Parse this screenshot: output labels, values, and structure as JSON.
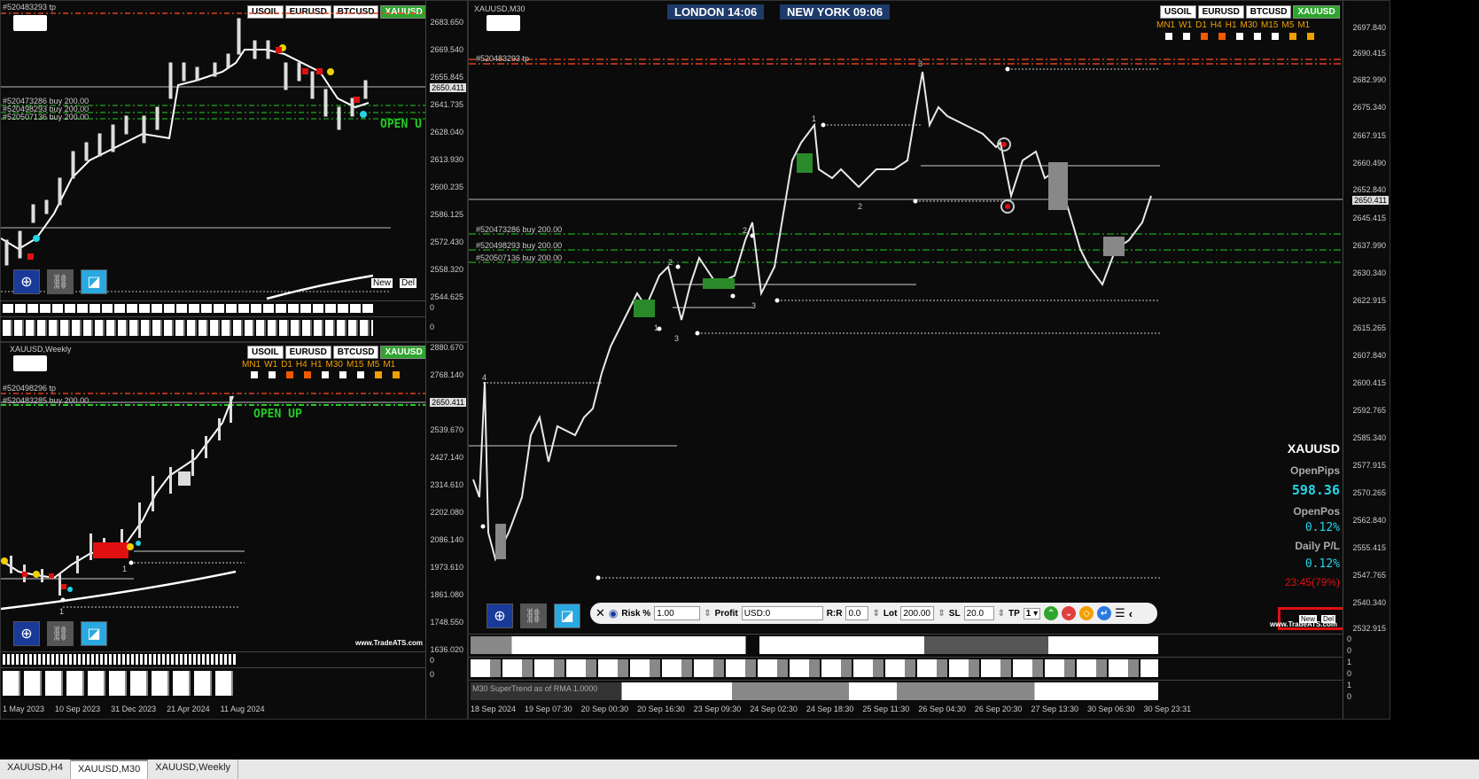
{
  "symbols": [
    "USOIL",
    "EURUSD",
    "BTCUSD",
    "XAUUSD"
  ],
  "active_symbol": "XAUUSD",
  "timeframes": [
    "MN1",
    "W1",
    "D1",
    "H4",
    "H1",
    "M30",
    "M15",
    "M5",
    "M1"
  ],
  "tabs": [
    {
      "label": "XAUUSD,H4"
    },
    {
      "label": "XAUUSD,M30"
    },
    {
      "label": "XAUUSD,Weekly"
    }
  ],
  "top_left": {
    "title": "#520483293 tp",
    "prices": [
      "2683.650",
      "2669.540",
      "2655.845",
      "2641.735",
      "2628.040",
      "2613.930",
      "2600.235",
      "2586.125",
      "2572.430",
      "2558.320",
      "2544.625"
    ],
    "current_price": "2650.411",
    "orders": [
      "#520473286 buy 200.00",
      "#520498293 buy 200.00",
      "#520507136 buy 200.00"
    ],
    "status": "OPEN U",
    "new_label": "New",
    "del_label": "Del",
    "indicator_zero": "0",
    "indicator_zero2": "0"
  },
  "bottom_left": {
    "title": "XAUUSD,Weekly",
    "tp_label": "#520498296 tp",
    "order_label": "#520483285 buy 200.00",
    "prices": [
      "2880.670",
      "2768.140",
      "2652.195",
      "2539.670",
      "2427.140",
      "2314.610",
      "2202.080",
      "2086.140",
      "1973.610",
      "1861.080",
      "1748.550",
      "1636.020"
    ],
    "current_price": "2650.411",
    "status": "OPEN UP",
    "watermark": "www.TradeATS.com",
    "dates": [
      "1 May 2023",
      "10 Sep 2023",
      "31 Dec 2023",
      "21 Apr 2024",
      "11 Aug 2024"
    ],
    "indicator_zero": "0",
    "indicator_zero2": "0",
    "wave_labels": [
      "1",
      "1"
    ]
  },
  "main": {
    "title": "XAUUSD,M30",
    "london": "LONDON  14:06",
    "newyork": "NEW YORK  09:06",
    "tp_label": "#520483293 tp",
    "orders": [
      "#520473286 buy 200.00",
      "#520498293 buy 200.00",
      "#520507136 buy 200.00"
    ],
    "prices": [
      "2697.840",
      "2690.415",
      "2682.990",
      "2675.340",
      "2667.915",
      "2660.490",
      "2652.840",
      "2645.415",
      "2637.990",
      "2630.340",
      "2622.915",
      "2615.265",
      "2607.840",
      "2600.415",
      "2592.765",
      "2585.340",
      "2577.915",
      "2570.265",
      "2562.840",
      "2555.415",
      "2547.765",
      "2540.340",
      "2532.915"
    ],
    "current_price": "2650.411",
    "wave_labels": {
      "w4": "4",
      "w1": "1",
      "w2a": "2",
      "w2b": "2",
      "w2c": "2",
      "w3a": "3",
      "w3b": "3",
      "w3c": "3",
      "w1b": "1"
    },
    "stats": {
      "symbol": "XAUUSD",
      "open_pips_label": "OpenPips",
      "open_pips": "598.36",
      "open_pos_label": "OpenPos",
      "open_pos": "0.12%",
      "daily_pl_label": "Daily P/L",
      "daily_pl": "0.12%",
      "countdown": "23:45(79%)"
    },
    "new_label": "New",
    "del_label": "Del",
    "watermark": "www.TradeATS.com",
    "indicator_label": "M30 SuperTrend as of RMA  1.0000",
    "indicator_axis": [
      "0",
      "0",
      "1",
      "0",
      "1",
      "0"
    ],
    "dates": [
      "18 Sep 2024",
      "19 Sep 07:30",
      "20 Sep 00:30",
      "20 Sep 16:30",
      "23 Sep 09:30",
      "24 Sep 02:30",
      "24 Sep 18:30",
      "25 Sep 11:30",
      "26 Sep 04:30",
      "26 Sep 20:30",
      "27 Sep 13:30",
      "30 Sep 06:30",
      "30 Sep 23:31"
    ]
  },
  "trade_panel": {
    "risk_label": "Risk %",
    "risk": "1.00",
    "profit_label": "Profit",
    "profit": "USD:0",
    "rr_label": "R:R",
    "rr": "0.0",
    "lot_label": "Lot",
    "lot": "200.00",
    "sl_label": "SL",
    "sl": "20.0",
    "tp_label": "TP",
    "tp": "1"
  },
  "colors": {
    "accent_green": "#2ea52e",
    "buy_line": "#22cc22",
    "tp_line": "#e0401a",
    "cyan": "#25d5e8",
    "red": "#e01010"
  }
}
